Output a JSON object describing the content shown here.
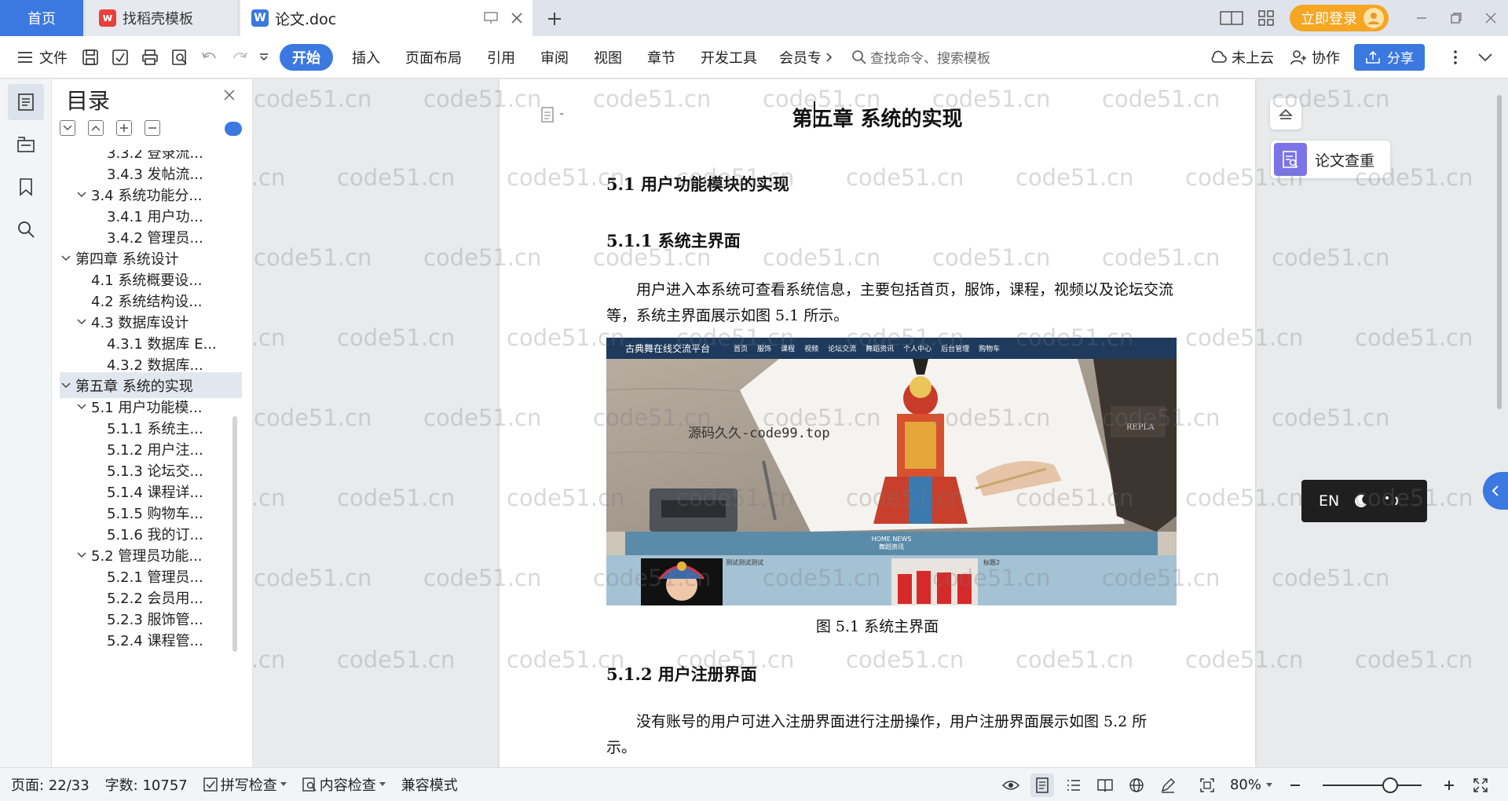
{
  "tabs": {
    "home": "首页",
    "template": "找稻壳模板",
    "doc": "论文.doc"
  },
  "account": {
    "login": "立即登录"
  },
  "ribbon": {
    "file": "文件",
    "start": "开始",
    "insert": "插入",
    "layout": "页面布局",
    "reference": "引用",
    "review": "审阅",
    "view": "视图",
    "chapter": "章节",
    "devtools": "开发工具",
    "member": "会员专",
    "search_placeholder": "查找命令、搜索模板",
    "cloud": "未上云",
    "collab": "协作",
    "share": "分享"
  },
  "toc": {
    "title": "目录",
    "items": [
      {
        "label": "3.3.2 登录流...",
        "level": 3
      },
      {
        "label": "3.4.3 发帖流...",
        "level": 3
      },
      {
        "label": "3.4 系统功能分...",
        "level": 2,
        "expanded": true
      },
      {
        "label": "3.4.1 用户功...",
        "level": 3
      },
      {
        "label": "3.4.2 管理员...",
        "level": 3
      },
      {
        "label": "第四章  系统设计",
        "level": 1,
        "expanded": true
      },
      {
        "label": "4.1 系统概要设...",
        "level": 2
      },
      {
        "label": "4.2  系统结构设...",
        "level": 2
      },
      {
        "label": "4.3  数据库设计",
        "level": 2,
        "expanded": true
      },
      {
        "label": "4.3.1 数据库 E...",
        "level": 3
      },
      {
        "label": "4.3.2 数据库...",
        "level": 3
      },
      {
        "label": "第五章  系统的实现",
        "level": 1,
        "expanded": true,
        "selected": true
      },
      {
        "label": "5.1  用户功能模...",
        "level": 2,
        "expanded": true
      },
      {
        "label": "5.1.1 系统主...",
        "level": 3
      },
      {
        "label": "5.1.2 用户注...",
        "level": 3
      },
      {
        "label": "5.1.3 论坛交...",
        "level": 3
      },
      {
        "label": "5.1.4 课程详...",
        "level": 3
      },
      {
        "label": "5.1.5 购物车...",
        "level": 3
      },
      {
        "label": "5.1.6 我的订...",
        "level": 3
      },
      {
        "label": "5.2  管理员功能...",
        "level": 2,
        "expanded": true
      },
      {
        "label": "5.2.1 管理员...",
        "level": 3
      },
      {
        "label": "5.2.2 会员用...",
        "level": 3
      },
      {
        "label": "5.2.3 服饰管...",
        "level": 3
      },
      {
        "label": "5.2.4 课程管...",
        "level": 3
      }
    ]
  },
  "document": {
    "chapter_title": "第五章  系统的实现",
    "h51": "5.1  用户功能模块的实现",
    "h511": "5.1.1 系统主界面",
    "p1": "用户进入本系统可查看系统信息，主要包括首页，服饰，课程，视频以及论坛交流等，系统主界面展示如图 5.1 所示。",
    "figure_caption": "图 5.1 系统主界面",
    "h512": "5.1.2 用户注册界面",
    "p2": "没有账号的用户可进入注册界面进行注册操作，用户注册界面展示如图 5.2 所示。"
  },
  "figure": {
    "brand": "古典舞在线交流平台",
    "nav": [
      "首页",
      "服饰",
      "课程",
      "视频",
      "论坛交流",
      "舞蹈资讯",
      "个人中心",
      "后台管理",
      "购物车"
    ],
    "watermark": "源码久久-code99.top",
    "news_en": "HOME NEWS",
    "news_cn": "舞蹈资讯",
    "card1": "测试测试测试",
    "card2": "标题2",
    "book_text": "REPLA"
  },
  "side": {
    "check": "论文查重",
    "ime_lang": "EN"
  },
  "watermark_text": "code51.cn",
  "status": {
    "page": "页面: 22/33",
    "words": "字数: 10757",
    "spell": "拼写检查",
    "content": "内容检查",
    "compat": "兼容模式",
    "zoom": "80%"
  },
  "colors": {
    "accent": "#3b78e0",
    "login": "#f5a623",
    "check_icon": "#7b74e8"
  }
}
